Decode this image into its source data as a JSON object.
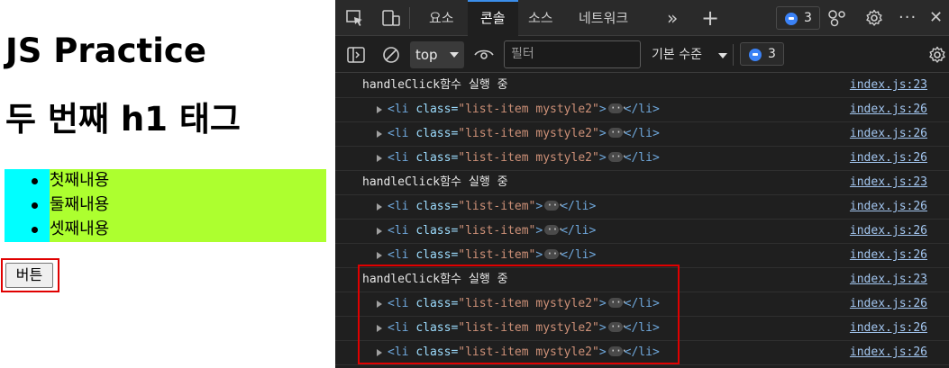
{
  "page": {
    "heading1": "JS Practice",
    "heading2": "두 번째 h1 태그",
    "list": [
      "첫째내용",
      "둘째내용",
      "셋째내용"
    ],
    "button_label": "버튼"
  },
  "devtools": {
    "tabs": [
      "요소",
      "콘솔",
      "소스",
      "네트워크"
    ],
    "active_tab": "콘솔",
    "more_tabs_icon": "»",
    "add_tab_icon": "+",
    "issues_count": "3",
    "more_icon": "···",
    "close_icon": "✕",
    "context_select": "top",
    "filter_placeholder": "필터",
    "log_level": "기본 수준",
    "filter_issues_count": "3",
    "colors": {
      "background": "#1f1f1f",
      "accent": "#3b8eea",
      "link": "#a3c6f0"
    },
    "console": [
      {
        "type": "log",
        "text": "handleClick함수 실행 중",
        "source": "index.js:23"
      },
      {
        "type": "element",
        "class": "list-item mystyle2",
        "source": "index.js:26"
      },
      {
        "type": "element",
        "class": "list-item mystyle2",
        "source": "index.js:26"
      },
      {
        "type": "element",
        "class": "list-item mystyle2",
        "source": "index.js:26"
      },
      {
        "type": "log",
        "text": "handleClick함수 실행 중",
        "source": "index.js:23"
      },
      {
        "type": "element",
        "class": "list-item",
        "source": "index.js:26"
      },
      {
        "type": "element",
        "class": "list-item",
        "source": "index.js:26"
      },
      {
        "type": "element",
        "class": "list-item",
        "source": "index.js:26"
      },
      {
        "type": "log",
        "text": "handleClick함수 실행 중",
        "source": "index.js:23"
      },
      {
        "type": "element",
        "class": "list-item mystyle2",
        "source": "index.js:26"
      },
      {
        "type": "element",
        "class": "list-item mystyle2",
        "source": "index.js:26"
      },
      {
        "type": "element",
        "class": "list-item mystyle2",
        "source": "index.js:26"
      }
    ]
  }
}
